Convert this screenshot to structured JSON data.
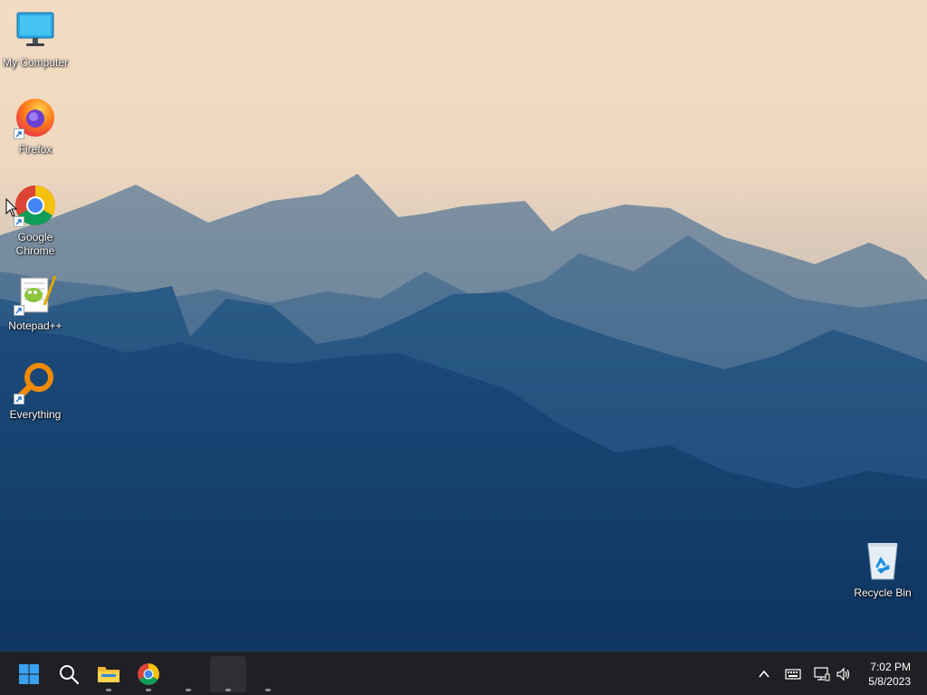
{
  "desktop": {
    "icons": [
      {
        "label": "My Computer"
      },
      {
        "label": "Firefox"
      },
      {
        "label": "Google Chrome"
      },
      {
        "label": "Notepad++"
      },
      {
        "label": "Everything"
      },
      {
        "label": "Recycle Bin"
      }
    ]
  },
  "taskbar": {
    "pinned": [
      {
        "icon": "windows-start-icon"
      },
      {
        "icon": "search-icon"
      },
      {
        "icon": "file-explorer-icon"
      },
      {
        "icon": "chrome-icon"
      },
      {
        "icon": "blank-app-icon"
      },
      {
        "icon": "blank-app-icon"
      },
      {
        "icon": "blank-app-icon"
      }
    ],
    "tray": {
      "icons": [
        "chevron-up-icon",
        "keyboard-icon",
        "network-icon",
        "volume-icon"
      ]
    },
    "clock": {
      "time": "7:02 PM",
      "date": "5/8/2023"
    }
  },
  "colors": {
    "taskbar_bg": "#1f2023",
    "sky_top": "#f3dcc4",
    "mountain_deep": "#0f3560"
  }
}
